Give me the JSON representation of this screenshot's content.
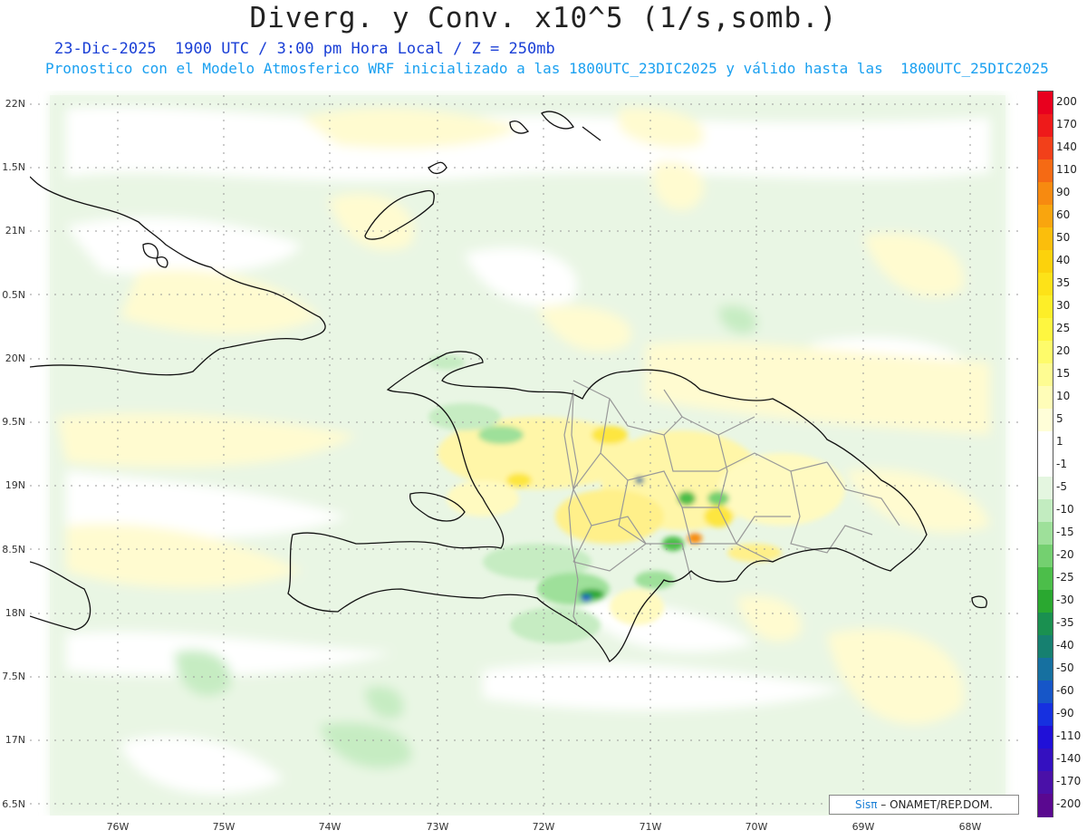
{
  "title": "Diverg. y Conv. x10^5 (1/s,somb.)",
  "subtitle_line1": "23-Dic-2025  1900 UTC / 3:00 pm Hora Local / Z = 250mb",
  "subtitle_line2": "Pronostico con el Modelo Atmosferico WRF inicializado a las 1800UTC_23DIC2025 y válido hasta las  1800UTC_25DIC2025",
  "lat_ticks": [
    "22N",
    "1.5N",
    "21N",
    "0.5N",
    "20N",
    "9.5N",
    "19N",
    "8.5N",
    "18N",
    "7.5N",
    "17N",
    "6.5N"
  ],
  "lon_ticks": [
    "76W",
    "75W",
    "74W",
    "73W",
    "72W",
    "71W",
    "70W",
    "69W",
    "68W"
  ],
  "colorbar": {
    "labels": [
      "200",
      "170",
      "140",
      "110",
      "90",
      "60",
      "50",
      "40",
      "35",
      "30",
      "25",
      "20",
      "15",
      "10",
      "5",
      "1",
      "-1",
      "-5",
      "-10",
      "-15",
      "-20",
      "-25",
      "-30",
      "-35",
      "-40",
      "-50",
      "-60",
      "-90",
      "-110",
      "-140",
      "-170",
      "-200"
    ],
    "colors": [
      "#e8001e",
      "#ee1a1a",
      "#f2401a",
      "#f56a14",
      "#f78a10",
      "#f9a50e",
      "#fbbe0c",
      "#fcd20c",
      "#fde218",
      "#fdee28",
      "#fef640",
      "#fefb6a",
      "#fefc92",
      "#fffdb8",
      "#fffed8",
      "#ffffff",
      "#ffffff",
      "#e4f6e0",
      "#c2ecc0",
      "#9ee09a",
      "#74d070",
      "#4cbe4a",
      "#2aa830",
      "#1a9050",
      "#168070",
      "#1670a0",
      "#1656c8",
      "#1630e0",
      "#2010d8",
      "#3410c0",
      "#4a10a8",
      "#5a0890"
    ]
  },
  "credit": {
    "sis": "Sisπ",
    "rest": " – ONAMET/REP.DOM."
  }
}
